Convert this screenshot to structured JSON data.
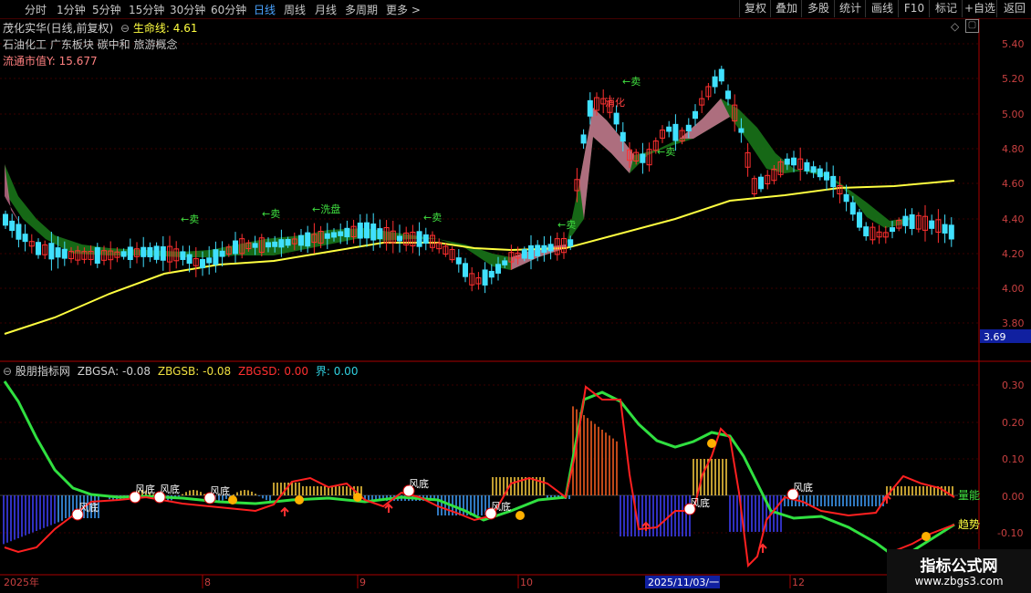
{
  "toolbar": {
    "periods": [
      "分时",
      "1分钟",
      "5分钟",
      "15分钟",
      "30分钟",
      "60分钟",
      "日线",
      "周线",
      "月线",
      "多周期",
      "更多 >"
    ],
    "active_period": "日线",
    "right_buttons": [
      "复权",
      "叠加",
      "多股",
      "统计",
      "画线",
      "F10",
      "标记",
      "+自选",
      "返回"
    ]
  },
  "main_panel": {
    "stock_title": "茂化实华(日线,前复权)",
    "indicator_name": "生命线:",
    "indicator_value": "4.61",
    "sectors": "石油化工 广东板块 碳中和 旅游概念",
    "float_cap_label": "流通市值Y:",
    "float_cap_value": "15.677",
    "price_axis": [
      "5.40",
      "5.20",
      "5.00",
      "4.80",
      "4.60",
      "4.40",
      "4.20",
      "4.00",
      "3.80"
    ],
    "current_price_tag": "3.69",
    "signal_labels": [
      "←卖",
      "←卖",
      "←洗盘",
      "←卖",
      "←卖",
      "←卖",
      "←卖",
      "消化"
    ]
  },
  "sub_panel": {
    "title": "股朋指标网",
    "readouts": [
      {
        "label": "ZBGSA:",
        "value": "-0.08",
        "color": "#d0d0d0"
      },
      {
        "label": "ZBGSB:",
        "value": "-0.08",
        "color": "#f0e040"
      },
      {
        "label": "ZBGSD:",
        "value": "0.00",
        "color": "#ff3030"
      },
      {
        "label": "界:",
        "value": "0.00",
        "color": "#30d0e0"
      }
    ],
    "axis": [
      "0.30",
      "0.20",
      "0.10",
      "0.00",
      "-0.10"
    ],
    "right_labels": [
      "量能",
      "趋势"
    ],
    "bottom_labels": [
      "风底",
      "风底",
      "风底",
      "风底",
      "风底",
      "风底",
      "风底",
      "风底"
    ]
  },
  "time_axis": [
    "2025年",
    "8",
    "9",
    "10",
    "2025/11/03/一",
    "12"
  ],
  "watermark": {
    "title": "指标公式网",
    "url": "www.zbgs3.com"
  },
  "colors": {
    "up": "#ff3030",
    "down": "#40e0ff",
    "life_line": "#ffff40",
    "ribbon_green": "#1a7a1a",
    "ribbon_pink": "#c87090"
  }
}
